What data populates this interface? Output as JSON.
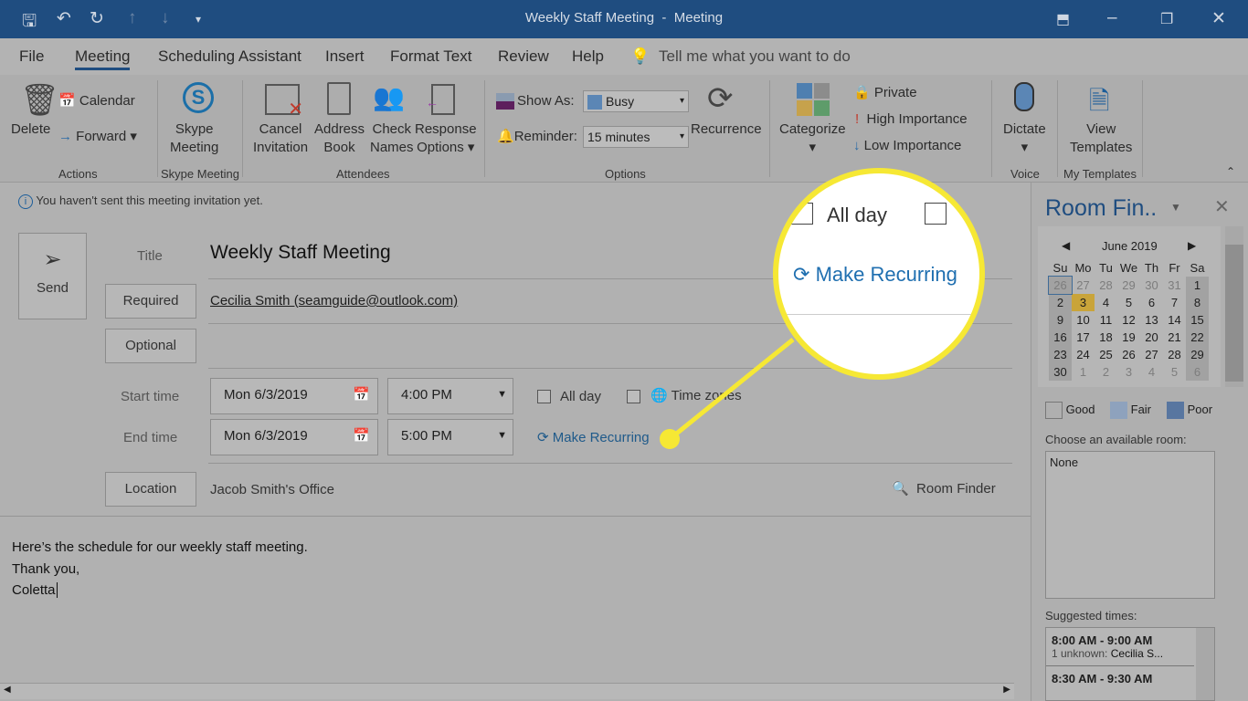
{
  "window": {
    "title": "Weekly Staff Meeting",
    "separator": "-",
    "type": "Meeting"
  },
  "tabs": [
    "File",
    "Meeting",
    "Scheduling Assistant",
    "Insert",
    "Format Text",
    "Review",
    "Help"
  ],
  "tell_me": "Tell me what you want to do",
  "ribbon": {
    "delete": "Delete",
    "calendar": "Calendar",
    "forward": "Forward",
    "actions": "Actions",
    "skype_1": "Skype",
    "skype_2": "Meeting",
    "skype_group": "Skype Meeting",
    "cancel_1": "Cancel",
    "cancel_2": "Invitation",
    "address_1": "Address",
    "address_2": "Book",
    "check_1": "Check",
    "check_2": "Names",
    "response_1": "Response",
    "response_2": "Options",
    "attendees": "Attendees",
    "show_as": "Show As:",
    "show_as_value": "Busy",
    "reminder": "Reminder:",
    "reminder_value": "15 minutes",
    "recurrence": "Recurrence",
    "options": "Options",
    "categorize": "Categorize",
    "private": "Private",
    "high": "High Importance",
    "low": "Low Importance",
    "dictate": "Dictate",
    "voice": "Voice",
    "view_1": "View",
    "view_2": "Templates",
    "my_templates": "My Templates"
  },
  "info": "You haven't sent this meeting invitation yet.",
  "form": {
    "send": "Send",
    "title_label": "Title",
    "title": "Weekly Staff Meeting",
    "required": "Required",
    "required_value": "Cecilia Smith (seamguide@outlook.com)",
    "optional": "Optional",
    "start_label": "Start time",
    "start_date": "Mon 6/3/2019",
    "start_time": "4:00 PM",
    "end_label": "End time",
    "end_date": "Mon 6/3/2019",
    "end_time": "5:00 PM",
    "all_day": "All day",
    "time_zones": "Time zones",
    "make_recurring": "Make Recurring",
    "location": "Location",
    "location_value": "Jacob Smith's Office",
    "room_finder": "Room Finder"
  },
  "body": [
    "Here’s the schedule for our weekly staff meeting.",
    "Thank you,",
    "Coletta"
  ],
  "magnifier": {
    "all_day": "All day",
    "make_recurring": "Make Recurring",
    "highlight_color": "#f6e834"
  },
  "room_finder": {
    "title": "Room Fin..",
    "month": "June 2019",
    "days": [
      "Su",
      "Mo",
      "Tu",
      "We",
      "Th",
      "Fr",
      "Sa"
    ],
    "weeks": [
      [
        "26",
        "27",
        "28",
        "29",
        "30",
        "31",
        "1"
      ],
      [
        "2",
        "3",
        "4",
        "5",
        "6",
        "7",
        "8"
      ],
      [
        "9",
        "10",
        "11",
        "12",
        "13",
        "14",
        "15"
      ],
      [
        "16",
        "17",
        "18",
        "19",
        "20",
        "21",
        "22"
      ],
      [
        "23",
        "24",
        "25",
        "26",
        "27",
        "28",
        "29"
      ],
      [
        "30",
        "1",
        "2",
        "3",
        "4",
        "5",
        "6"
      ]
    ],
    "legend": [
      "Good",
      "Fair",
      "Poor"
    ],
    "choose": "Choose an available room:",
    "room": "None",
    "suggested": "Suggested times:",
    "times": [
      {
        "range": "8:00 AM - 9:00 AM",
        "detail": "1 unknown:",
        "who": "Cecilia S..."
      },
      {
        "range": "8:30 AM - 9:30 AM"
      }
    ]
  }
}
